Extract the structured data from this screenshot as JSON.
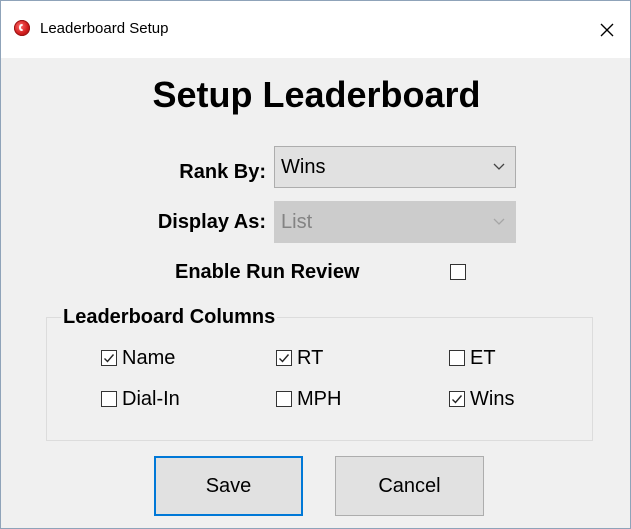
{
  "window": {
    "title": "Leaderboard Setup",
    "icon": "app-logo-icon",
    "close_icon": "close-icon"
  },
  "heading": "Setup Leaderboard",
  "rank_by": {
    "label": "Rank By:",
    "value": "Wins",
    "enabled": true
  },
  "display_as": {
    "label": "Display As:",
    "value": "List",
    "enabled": false
  },
  "run_review": {
    "label": "Enable Run Review",
    "checked": false
  },
  "columns_group": {
    "title": "Leaderboard Columns",
    "items": [
      {
        "label": "Name",
        "checked": true
      },
      {
        "label": "RT",
        "checked": true
      },
      {
        "label": "ET",
        "checked": false
      },
      {
        "label": "Dial-In",
        "checked": false
      },
      {
        "label": "MPH",
        "checked": false
      },
      {
        "label": "Wins",
        "checked": true
      }
    ]
  },
  "buttons": {
    "save": "Save",
    "cancel": "Cancel"
  },
  "colors": {
    "default_button_border": "#0078d7",
    "dialog_background": "#f0f0f0"
  }
}
